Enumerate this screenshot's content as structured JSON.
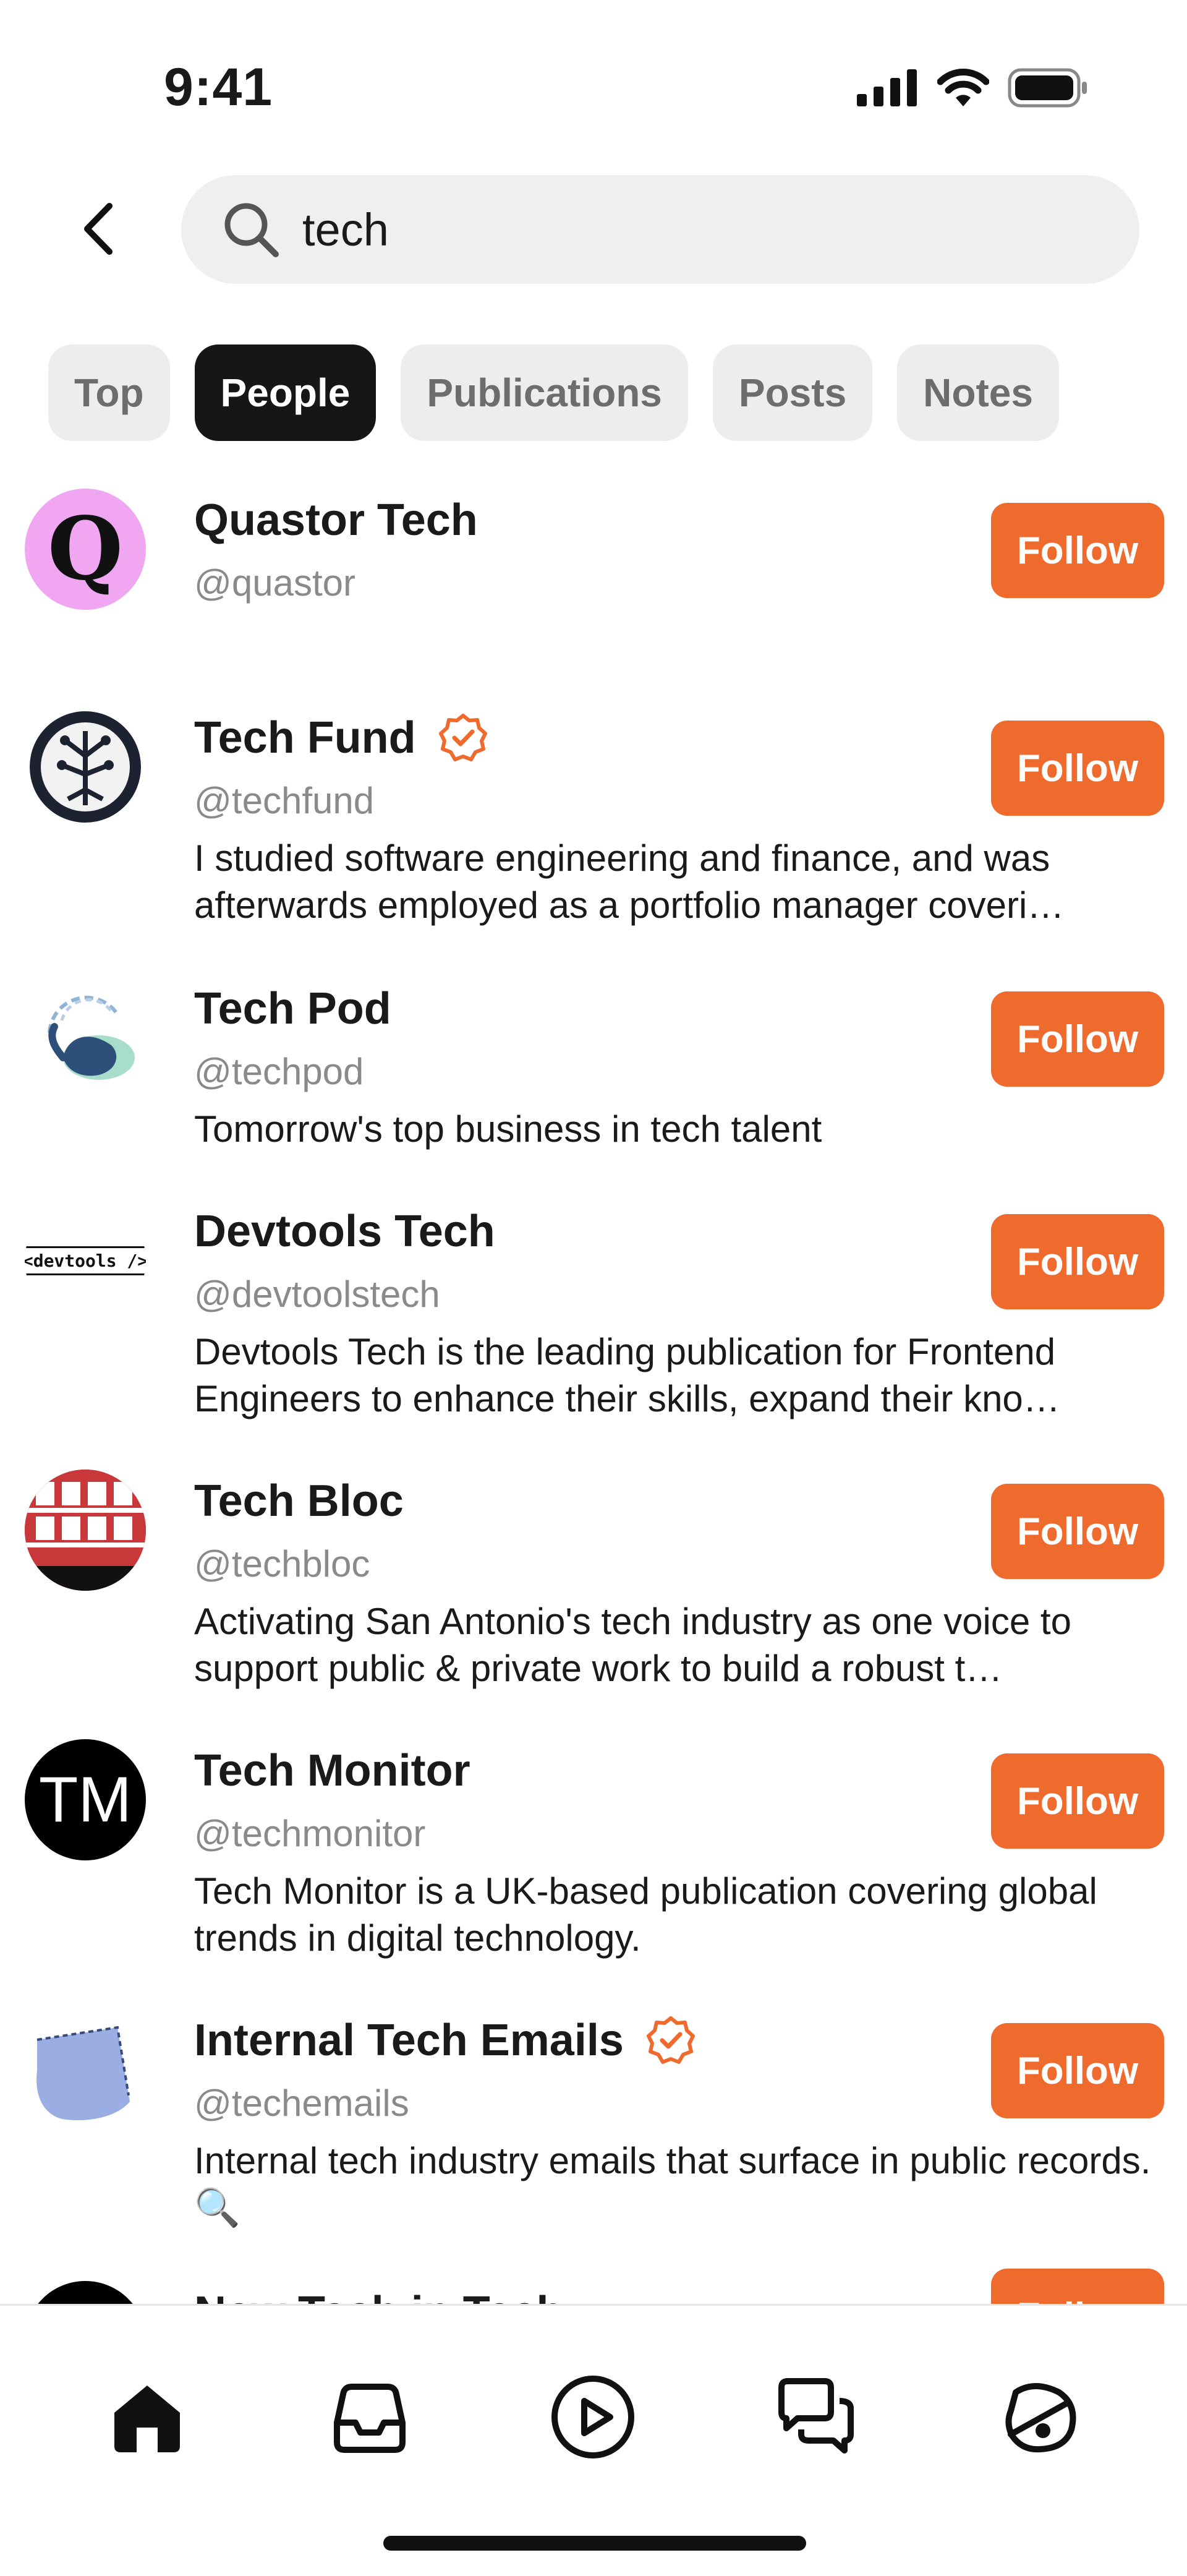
{
  "status": {
    "time": "9:41"
  },
  "search": {
    "query": "tech"
  },
  "tabs": [
    "Top",
    "People",
    "Publications",
    "Posts",
    "Notes"
  ],
  "active_tab": "People",
  "people": [
    {
      "name": "Quastor Tech",
      "handle": "@quastor",
      "verified": false,
      "description": "",
      "follow": "Follow",
      "avatar_text": "Q"
    },
    {
      "name": "Tech Fund",
      "handle": "@techfund",
      "verified": true,
      "description": "I studied software engineering and finance, and was afterwards employed as a portfolio manager coveri…",
      "follow": "Follow"
    },
    {
      "name": "Tech Pod",
      "handle": "@techpod",
      "verified": false,
      "description": "Tomorrow's top business in tech talent",
      "follow": "Follow"
    },
    {
      "name": "Devtools Tech",
      "handle": "@devtoolstech",
      "verified": false,
      "description": "Devtools Tech is the leading publication for Frontend Engineers to enhance their skills, expand their kno…",
      "follow": "Follow",
      "avatar_text": "<devtools />"
    },
    {
      "name": "Tech Bloc",
      "handle": "@techbloc",
      "verified": false,
      "description": "Activating San Antonio's tech industry as one voice to support public & private work to build a robust t…",
      "follow": "Follow"
    },
    {
      "name": "Tech Monitor",
      "handle": "@techmonitor",
      "verified": false,
      "description": "Tech Monitor is a UK-based publication covering global trends in digital technology.",
      "follow": "Follow",
      "avatar_text": "TM"
    },
    {
      "name": "Internal Tech Emails",
      "handle": "@techemails",
      "verified": true,
      "description": "Internal tech industry emails that surface in public records. 🔍",
      "follow": "Follow"
    },
    {
      "name": "New Tech in Tech",
      "handle": "",
      "verified": false,
      "description": "",
      "follow": "Follow"
    }
  ],
  "colors": {
    "accent": "#ee6a2d",
    "tab_active_bg": "#161616",
    "tab_bg": "#ededed"
  },
  "bottom_nav": [
    "home-icon",
    "inbox-icon",
    "play-icon",
    "chat-icon",
    "profile-icon"
  ]
}
